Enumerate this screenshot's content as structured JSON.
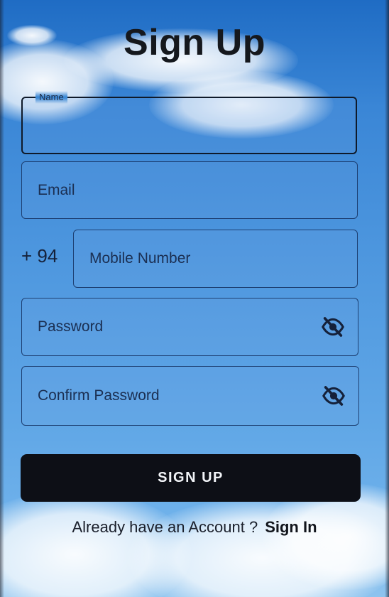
{
  "title": "Sign Up",
  "form": {
    "name": {
      "label": "Name",
      "value": ""
    },
    "email": {
      "placeholder": "Email"
    },
    "country_code": "+ 94",
    "mobile": {
      "placeholder": "Mobile Number"
    },
    "password": {
      "placeholder": "Password"
    },
    "confirm_password": {
      "placeholder": "Confirm Password"
    }
  },
  "icons": {
    "password_toggle": "eye-off-icon",
    "confirm_password_toggle": "eye-off-icon"
  },
  "signup_button_label": "SIGN UP",
  "footer": {
    "prompt": "Already have an Account ?",
    "link": "Sign In"
  },
  "colors": {
    "button_bg": "#0d0f16",
    "button_text": "#f2f4f8",
    "field_border": "#1d3f72",
    "sky_blue": "#3a86d6"
  }
}
